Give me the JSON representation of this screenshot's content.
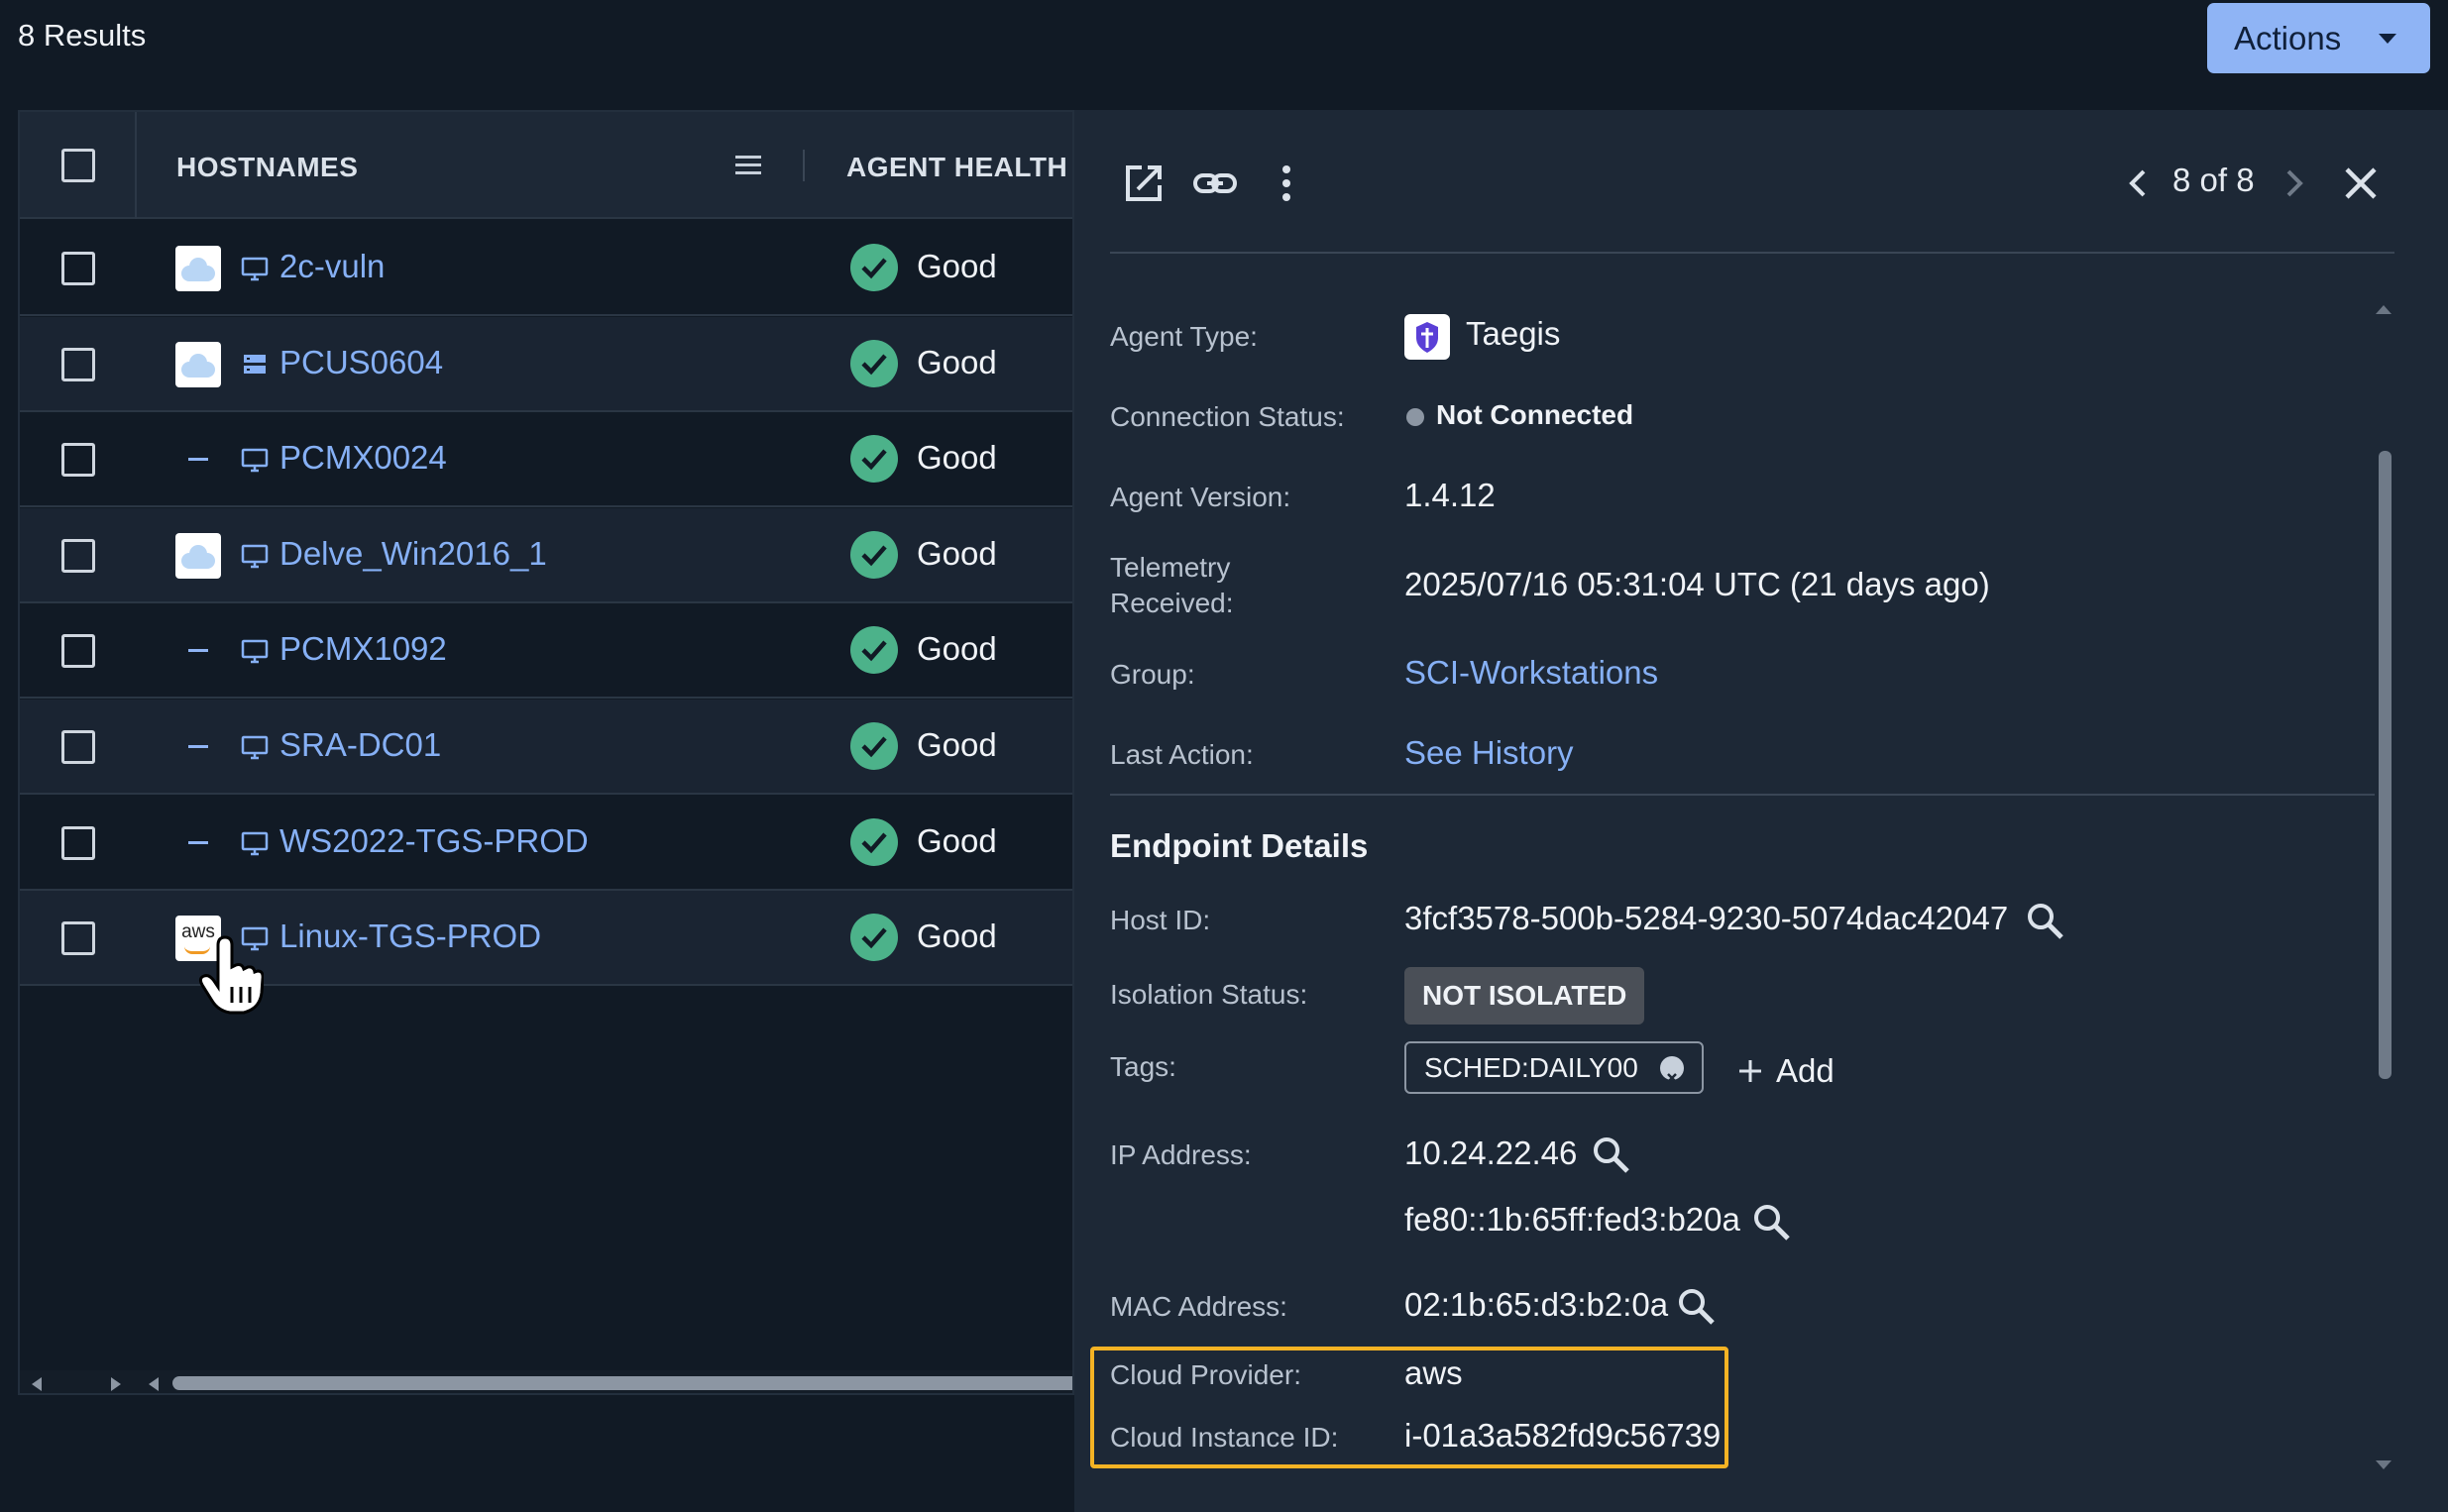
{
  "header": {
    "results_count": "8 Results",
    "actions_label": "Actions"
  },
  "table": {
    "columns": {
      "hostnames": "HOSTNAMES",
      "agent_health": "AGENT HEALTH"
    },
    "rows": [
      {
        "hostname": "2c-vuln",
        "source": "cloud",
        "device": "monitor",
        "health": "Good"
      },
      {
        "hostname": "PCUS0604",
        "source": "cloud",
        "device": "server",
        "health": "Good"
      },
      {
        "hostname": "PCMX0024",
        "source": "none",
        "device": "monitor",
        "health": "Good"
      },
      {
        "hostname": "Delve_Win2016_1",
        "source": "cloud",
        "device": "monitor",
        "health": "Good"
      },
      {
        "hostname": "PCMX1092",
        "source": "none",
        "device": "monitor",
        "health": "Good"
      },
      {
        "hostname": "SRA-DC01",
        "source": "none",
        "device": "monitor",
        "health": "Good"
      },
      {
        "hostname": "WS2022-TGS-PROD",
        "source": "none",
        "device": "monitor",
        "health": "Good"
      },
      {
        "hostname": "Linux-TGS-PROD",
        "source": "aws",
        "device": "monitor",
        "health": "Good"
      }
    ],
    "aws_badge_text": "aws"
  },
  "panel": {
    "pager": "8 of 8",
    "agent_type_label": "Agent Type:",
    "agent_type": "Taegis",
    "connection_status_label": "Connection Status:",
    "connection_status": "Not Connected",
    "agent_version_label": "Agent Version:",
    "agent_version": "1.4.12",
    "telemetry_label_1": "Telemetry",
    "telemetry_label_2": "Received:",
    "telemetry": "2025/07/16 05:31:04 UTC (21 days ago)",
    "group_label": "Group:",
    "group": "SCI-Workstations",
    "last_action_label": "Last Action:",
    "last_action": "See History",
    "endpoint_details_title": "Endpoint Details",
    "host_id_label": "Host ID:",
    "host_id": "3fcf3578-500b-5284-9230-5074dac42047",
    "isolation_label": "Isolation Status:",
    "isolation": "NOT ISOLATED",
    "tags_label": "Tags:",
    "tag": "SCHED:DAILY00",
    "add_tag": "Add",
    "ip_label": "IP Address:",
    "ip_v4": "10.24.22.46",
    "ip_v6": "fe80::1b:65ff:fed3:b20a",
    "mac_label": "MAC Address:",
    "mac": "02:1b:65:d3:b2:0a",
    "cloud_provider_label": "Cloud Provider:",
    "cloud_provider": "aws",
    "cloud_instance_label": "Cloud Instance ID:",
    "cloud_instance": "i-01a3a582fd9c56739"
  },
  "colors": {
    "accent_link": "#86b0f5",
    "actions_button": "#8fb4f5",
    "health_ok": "#4cb28a",
    "highlight": "#f5b324"
  }
}
